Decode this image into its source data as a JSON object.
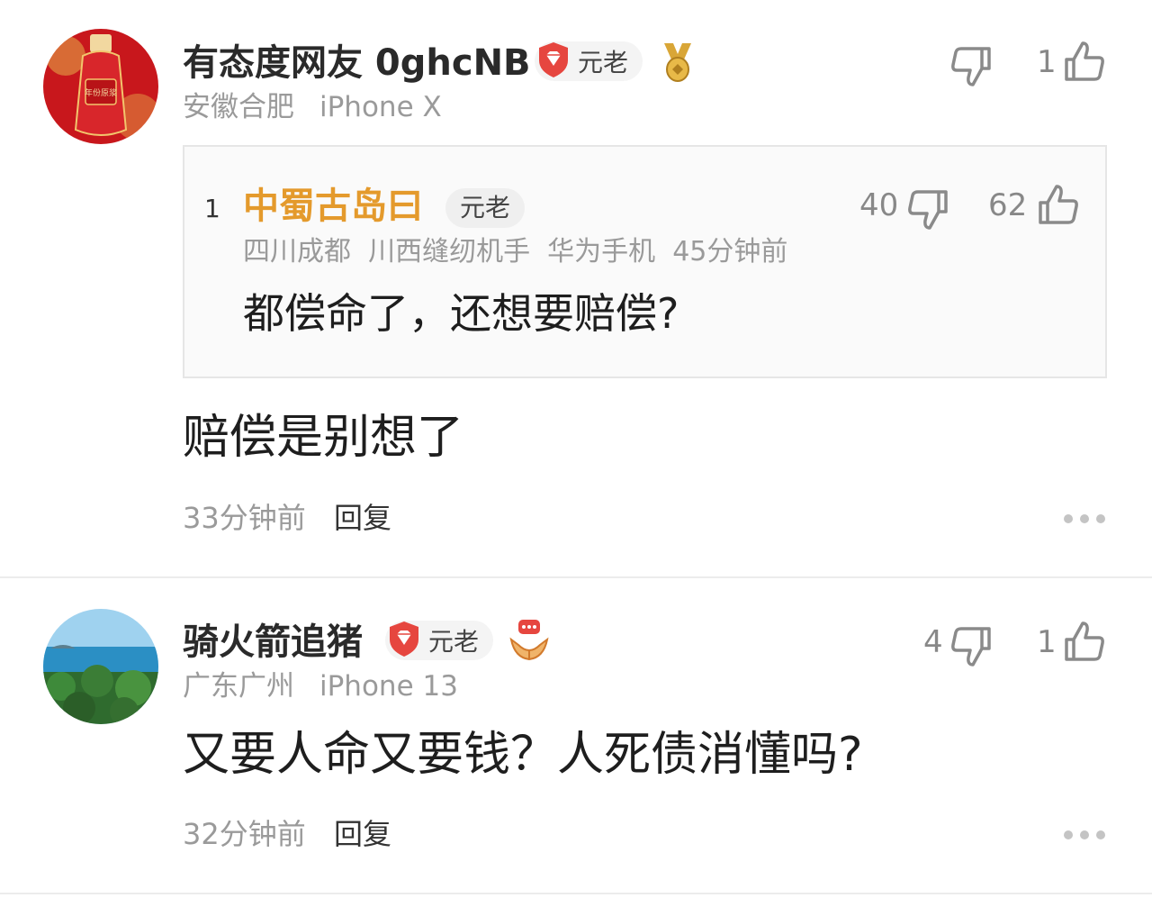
{
  "comments": [
    {
      "username": "有态度网友 0ghcNB",
      "level": "元老",
      "location": "安徽合肥",
      "device": "iPhone X",
      "dislike_count": "",
      "like_count": "1",
      "quote": {
        "index": "1",
        "username": "中蜀古岛曰",
        "level": "元老",
        "meta": "四川成都  川西缝纫机手  华为手机  45分钟前",
        "dislike_count": "40",
        "like_count": "62",
        "content": "都偿命了，还想要赔偿?"
      },
      "content": "赔偿是别想了",
      "time": "33分钟前",
      "reply_label": "回复"
    },
    {
      "username": "骑火箭追猪",
      "level": "元老",
      "location": "广东广州",
      "device": "iPhone 13",
      "dislike_count": "4",
      "like_count": "1",
      "content": "又要人命又要钱？人死债消懂吗?",
      "time": "32分钟前",
      "reply_label": "回复"
    }
  ],
  "colors": {
    "quote_username": "#e49a2c",
    "shield_red": "#e6463f",
    "medal_gold": "#d9a637",
    "icon_gray": "#8a8a8a"
  }
}
